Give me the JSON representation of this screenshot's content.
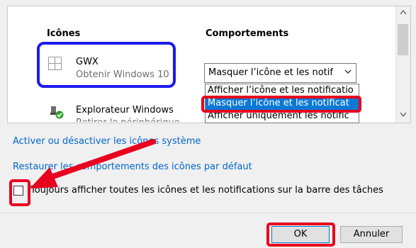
{
  "table": {
    "col_icons": "Icônes",
    "col_behaviors": "Comportements"
  },
  "rows": [
    {
      "title": "GWX",
      "subtitle": "Obtenir Windows 10",
      "icon": "windows-logo-icon"
    },
    {
      "title": "Explorateur Windows",
      "subtitle": "Retirer le périphérique",
      "icon": "usb-safely-remove-icon"
    }
  ],
  "select": {
    "value": "Masquer l’icône et les notif",
    "chevron": "⌄"
  },
  "dropdown": {
    "options": [
      "Afficher l’icône et les notificatio",
      "Masquer l’icône et les notificat",
      "Afficher uniquement les notific"
    ],
    "selected_index": 1
  },
  "links": {
    "toggle_system_icons": "Activer ou désactiver les icônes système",
    "restore_defaults": "Restaurer les comportements des icônes par défaut"
  },
  "checkbox": {
    "label": "Toujours afficher toutes les icônes et les notifications sur la barre des tâches",
    "checked": false
  },
  "buttons": {
    "ok": "OK",
    "cancel": "Annuler"
  },
  "annotation_colors": {
    "blue_frame": "#1b1bf0",
    "red_frame": "#e8001e",
    "arrow": "#e8001e"
  }
}
